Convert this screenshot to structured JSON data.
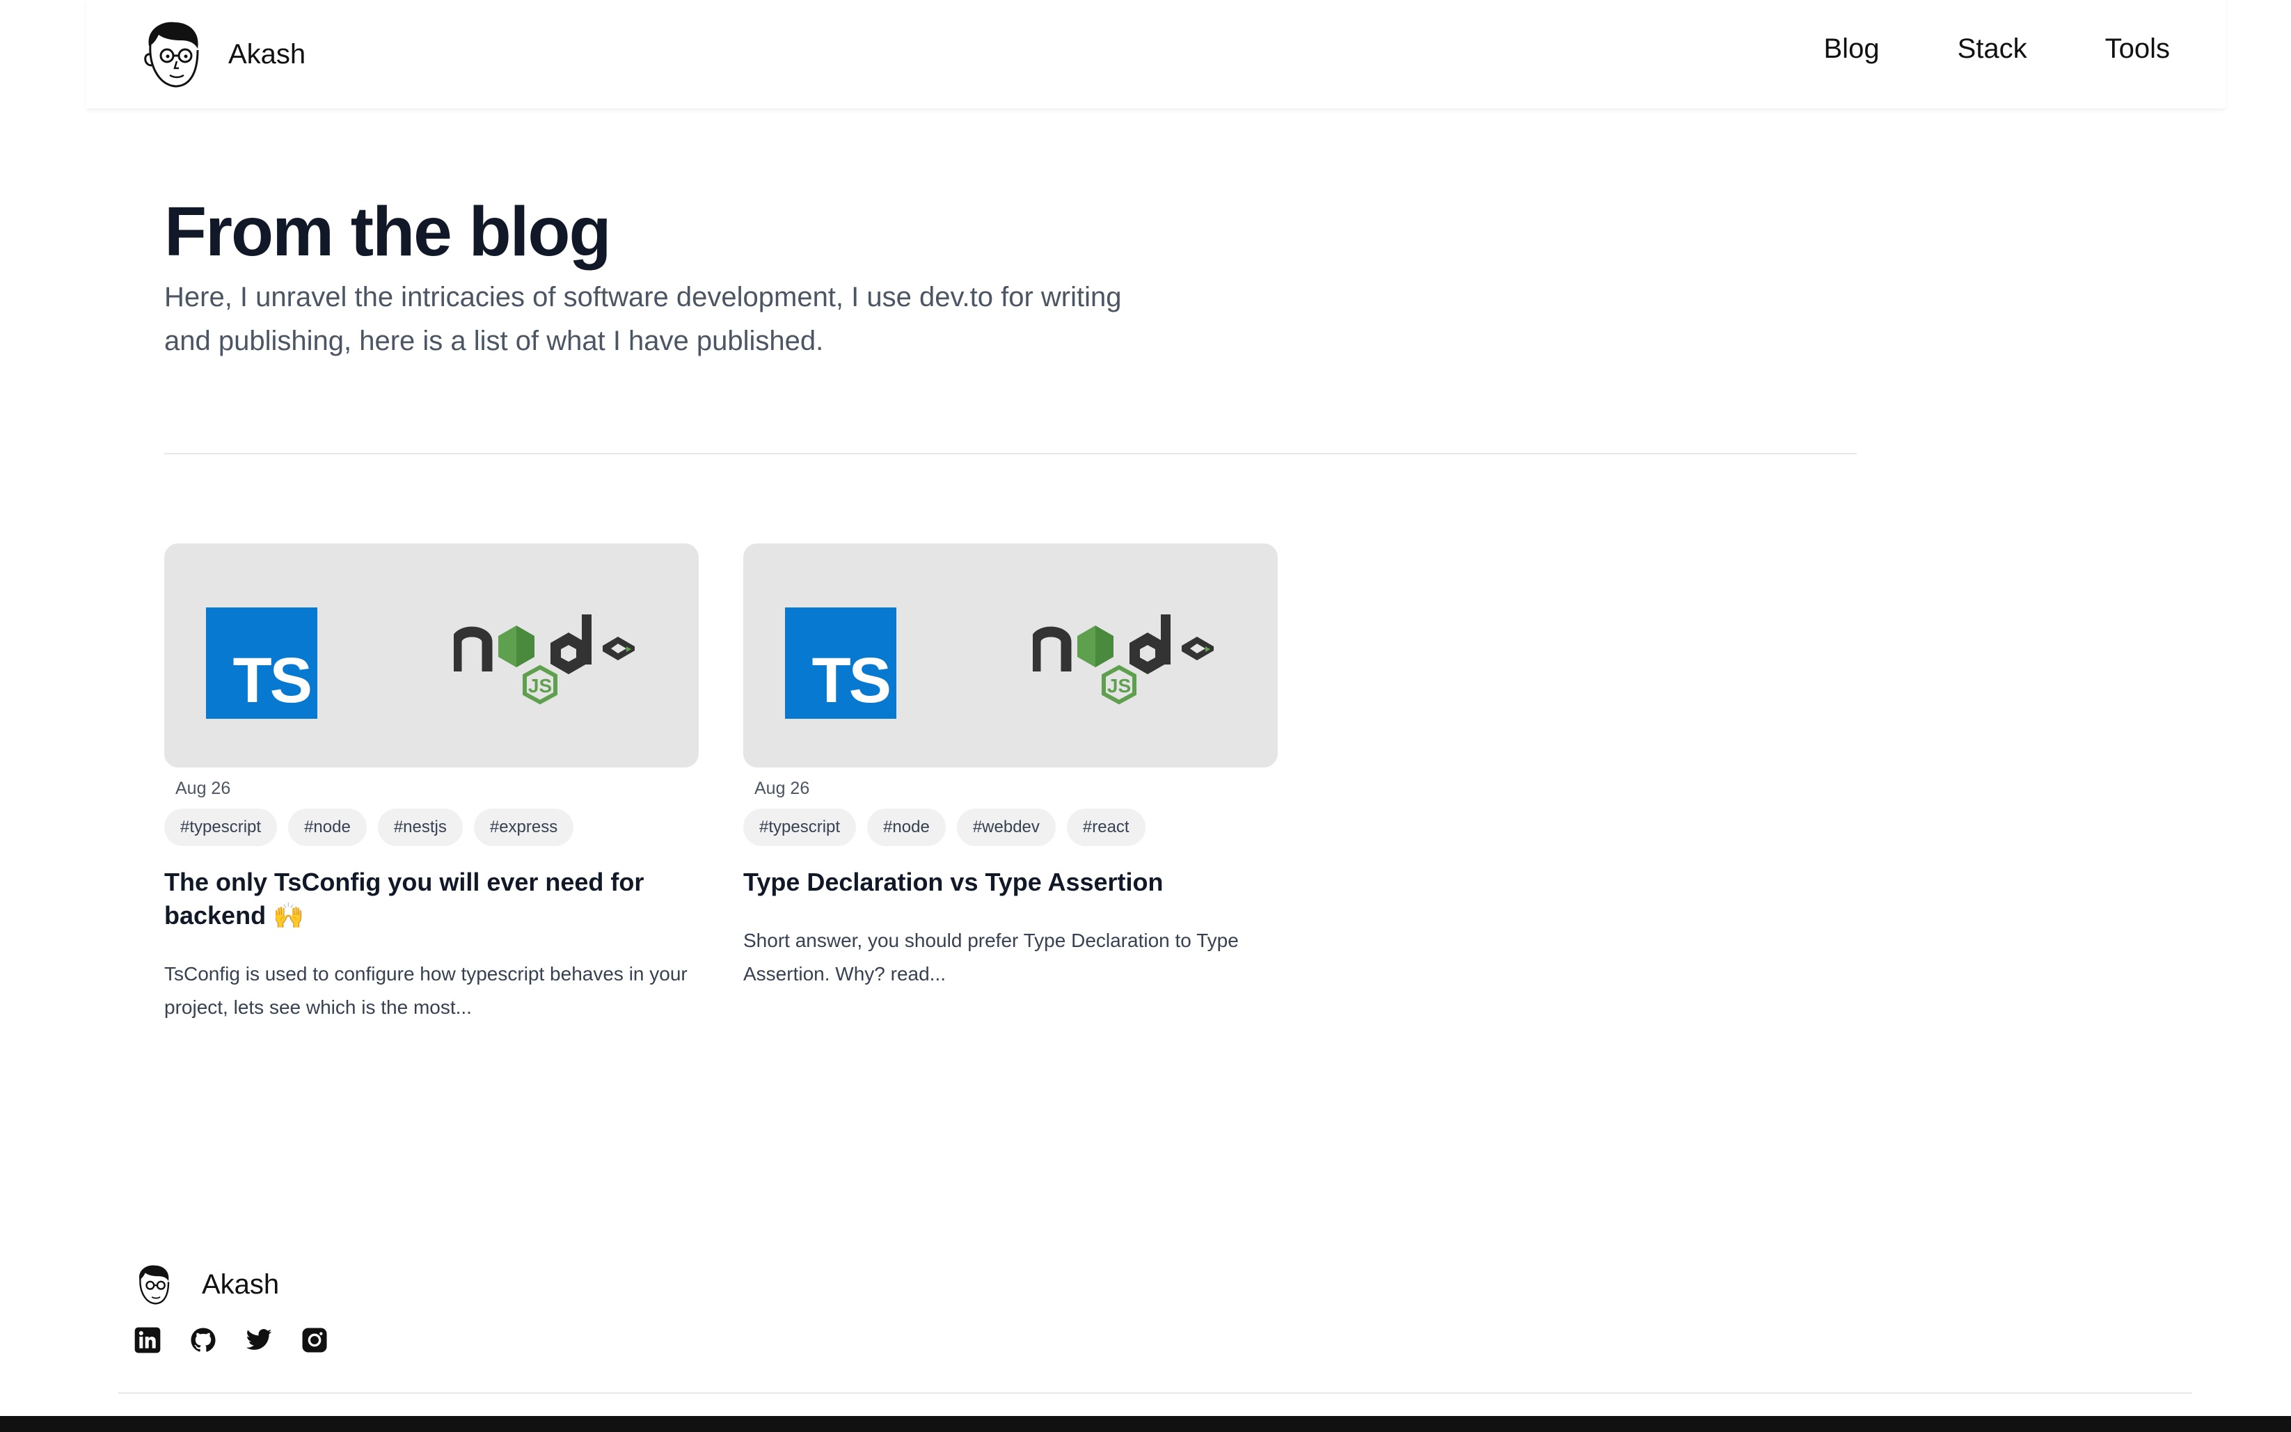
{
  "header": {
    "brand_name": "Akash",
    "nav": [
      {
        "label": "Blog"
      },
      {
        "label": "Stack"
      },
      {
        "label": "Tools"
      }
    ]
  },
  "hero": {
    "title": "From the blog",
    "intro": "Here, I unravel the intricacies of software development, I use dev.to for writing and publishing, here is a list of what I have published."
  },
  "posts": [
    {
      "image_text": "TS",
      "date": "Aug 26",
      "tags": [
        "#typescript",
        "#node",
        "#nestjs",
        "#express"
      ],
      "title": "The only TsConfig you will ever need for backend 🙌",
      "excerpt": "TsConfig is used to configure how typescript behaves in your project, lets see which is the most..."
    },
    {
      "image_text": "TS",
      "date": "Aug 26",
      "tags": [
        "#typescript",
        "#node",
        "#webdev",
        "#react"
      ],
      "title": "Type Declaration vs Type Assertion",
      "excerpt": "Short answer, you should prefer Type Declaration to Type Assertion. Why? read..."
    }
  ],
  "footer": {
    "brand_name": "Akash",
    "social": [
      "linkedin-icon",
      "github-icon",
      "twitter-icon",
      "instagram-icon"
    ]
  },
  "colors": {
    "ts_blue": "#0779d0",
    "node_green": "#5fa04e",
    "card_bg": "#e5e5e5",
    "tag_bg": "#f1f1f1"
  }
}
